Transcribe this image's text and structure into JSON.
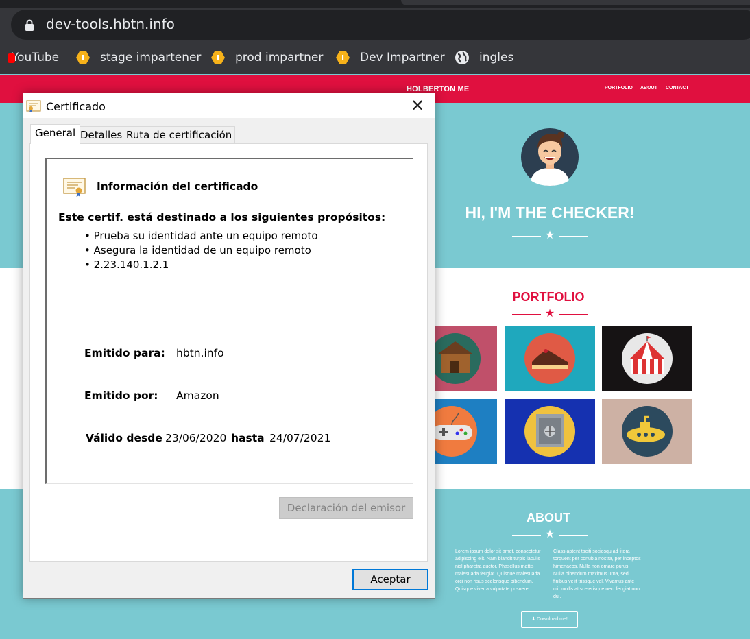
{
  "browser": {
    "url": "dev-tools.hbtn.info",
    "bookmarks": [
      {
        "label": "YouTube",
        "icon": "youtube-icon"
      },
      {
        "label": "stage impartener",
        "icon": "hexagon-icon"
      },
      {
        "label": "prod impartner",
        "icon": "hexagon-icon"
      },
      {
        "label": "Dev Impartner",
        "icon": "hexagon-icon"
      },
      {
        "label": "ingles",
        "icon": "globe-icon"
      }
    ]
  },
  "site": {
    "brand": "HOLBERTON ME",
    "nav": [
      "PORTFOLIO",
      "ABOUT",
      "CONTACT"
    ],
    "hero_title": "HI, I'M THE CHECKER!",
    "portfolio_title": "PORTFOLIO",
    "about_title": "ABOUT",
    "about_left": "Lorem ipsum dolor sit amet, consectetur adipiscing elit. Nam blandit turpis iaculis nisl pharetra auctor. Phasellus mattis malesuada feugiat. Quisque malesuada orci non risus scelerisque bibendum. Quisque viverra vulputate posuere.",
    "about_right": "Class aptent taciti sociosqu ad litora torquent per conubia nostra, per inceptos himenaeos. Nulla non ornare purus. Nulla bibendum maximus urna, sed finibus velit tristique vel. Vivamus ante mi, mollis at scelerisque nec, feugiat non dui.",
    "download_label": "Download me!",
    "colors": {
      "brand_red": "#e0103f",
      "teal": "#7ac9d1"
    },
    "tiles": [
      {
        "icon": "cabin-icon",
        "bg": "#c0506a"
      },
      {
        "icon": "cake-icon",
        "bg": "#1fa8bd"
      },
      {
        "icon": "circus-tent-icon",
        "bg": "#161314"
      },
      {
        "icon": "gamepad-icon",
        "bg": "#1e7fc2"
      },
      {
        "icon": "safe-icon",
        "bg": "#1531b0"
      },
      {
        "icon": "submarine-icon",
        "bg": "#cdb1a4"
      }
    ]
  },
  "dialog": {
    "title": "Certificado",
    "tabs": [
      "General",
      "Detalles",
      "Ruta de certificación"
    ],
    "heading": "Información del certificado",
    "purposes_title": "Este certif. está destinado a los siguientes propósitos:",
    "purposes": [
      "• Prueba su identidad ante un equipo remoto",
      "• Asegura la identidad de un equipo remoto",
      "• 2.23.140.1.2.1"
    ],
    "issued_to_label": "Emitido para:",
    "issued_to": "hbtn.info",
    "issued_by_label": "Emitido por:",
    "issued_by": "Amazon",
    "valid_from_label": "Válido desde",
    "valid_from": "23/06/2020",
    "valid_to_label": "hasta",
    "valid_to": "24/07/2021",
    "issuer_statement_button": "Declaración del emisor",
    "ok_button": "Aceptar",
    "close_symbol": "✕"
  }
}
